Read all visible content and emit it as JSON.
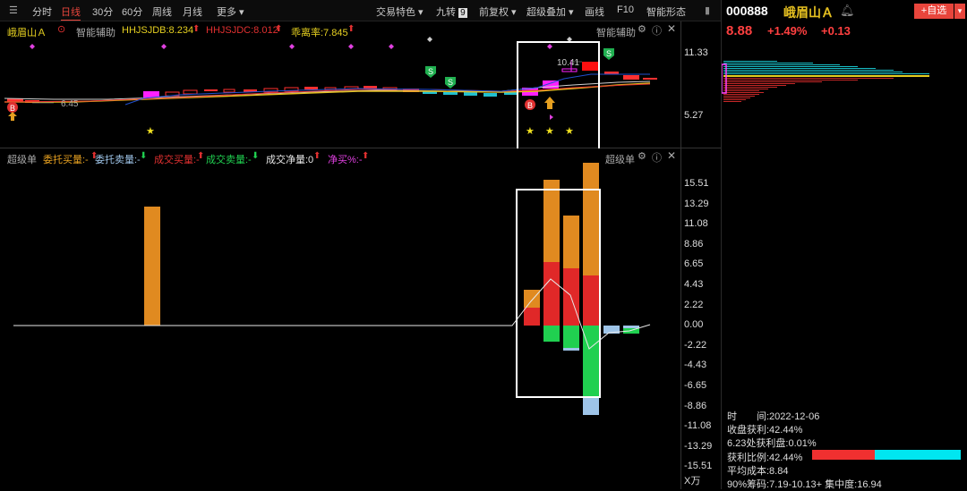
{
  "toolbar": {
    "left_items": [
      "分时",
      "日线",
      "30分",
      "60分",
      "周线",
      "月线",
      "更多"
    ],
    "active": "日线",
    "right_items": [
      "交易特色",
      "九转",
      "前复权",
      "超级叠加",
      "画线",
      "F10",
      "智能形态"
    ],
    "jiuzhuan_badge": "9"
  },
  "kline_panel": {
    "stock_label": "峨眉山Ａ",
    "assist_label": "智能辅助",
    "assist_label_right": "智能辅助",
    "indicators": [
      {
        "text": "HHJSJDB:8.234",
        "color": "#e6d020"
      },
      {
        "text": "HHJSJDC:8.012",
        "color": "#e03030"
      },
      {
        "text": "乖离率:7.845",
        "color": "#e6d020"
      }
    ],
    "axis_labels": [
      "11.33",
      "5.27"
    ],
    "annotations": {
      "high_price": "10.41",
      "low_price": "6.45",
      "buy_marker": "B",
      "sell_marker": "S"
    }
  },
  "volume_panel": {
    "title": "超级单",
    "title_right": "超级单",
    "legend": [
      {
        "text": "委托买量:-",
        "color": "#e6a020"
      },
      {
        "text": "委托卖量:-",
        "color": "#9ec4e8"
      },
      {
        "text": "成交买量:-",
        "color": "#e03030"
      },
      {
        "text": "成交卖量:-",
        "color": "#20d050"
      },
      {
        "text": "成交净量:0",
        "color": "#e8e8e8"
      },
      {
        "text": "净买%:-",
        "color": "#e040e0"
      }
    ],
    "axis_labels": [
      "15.51",
      "13.29",
      "11.08",
      "8.86",
      "6.65",
      "4.43",
      "2.22",
      "0.00",
      "-2.22",
      "-4.43",
      "-6.65",
      "-8.86",
      "-11.08",
      "-13.29",
      "-15.51"
    ],
    "unit": "X万"
  },
  "right_panel": {
    "code": "000888",
    "name": "峨眉山Ａ",
    "price": "8.88",
    "change_pct": "+1.49%",
    "change": "+0.13",
    "add_button": "+自选",
    "stats": {
      "time": "时　　间:2022-12-06",
      "profit": "收盘获利:42.44%",
      "profit_at": "6.23处获利盘:0.01%",
      "ratio": "获利比例:42.44%",
      "avg_cost": "平均成本:8.84",
      "chips": "90%筹码:7.19-10.13+ 集中度:16.94"
    },
    "ratio_value": 0.4244
  },
  "colors": {
    "up": "#ff4040",
    "down": "#20d050",
    "accent": "#e8453c",
    "cyan": "#00e0e0"
  }
}
